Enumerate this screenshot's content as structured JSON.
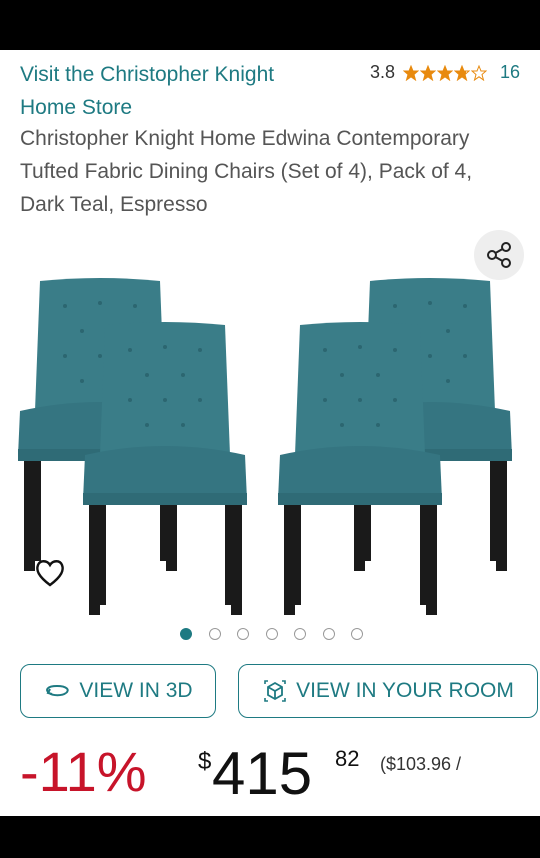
{
  "store": {
    "link_text": "Visit the Christopher Knight Home Store"
  },
  "rating": {
    "value": "3.8",
    "stars": 3.8,
    "count": "16",
    "star_color": "#e88a0f"
  },
  "product": {
    "title": "Christopher Knight Home Edwina Contemporary Tufted Fabric Dining Chairs (Set of 4), Pack of 4, Dark Teal, Espresso"
  },
  "gallery": {
    "total_images": 7,
    "active_index": 0
  },
  "buttons": {
    "view_3d": "VIEW IN 3D",
    "view_room": "VIEW IN YOUR ROOM"
  },
  "price": {
    "discount": "-11%",
    "currency": "$",
    "whole": "415",
    "fraction": "82",
    "unit_price": "($103.96 /"
  },
  "colors": {
    "accent": "#1e7a82",
    "discount": "#c7142a",
    "chair_fabric": "#3a7d88",
    "chair_legs": "#1a1a1a"
  },
  "icons": {
    "share": "share-icon",
    "wishlist": "heart-icon",
    "view_3d": "rotate-3d-icon",
    "view_room": "cube-ar-icon"
  }
}
